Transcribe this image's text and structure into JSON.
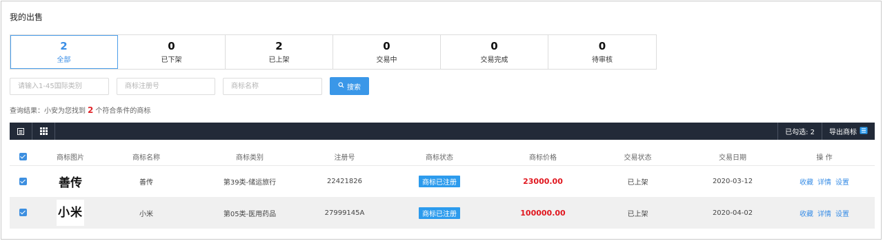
{
  "page": {
    "title": "我的出售"
  },
  "stats": [
    {
      "count": "2",
      "label": "全部",
      "active": true
    },
    {
      "count": "0",
      "label": "已下架"
    },
    {
      "count": "2",
      "label": "已上架"
    },
    {
      "count": "0",
      "label": "交易中"
    },
    {
      "count": "0",
      "label": "交易完成"
    },
    {
      "count": "0",
      "label": "待审核"
    }
  ],
  "filters": {
    "class_placeholder": "请输入1-45国际类别",
    "reg_no_placeholder": "商标注册号",
    "name_placeholder": "商标名称",
    "search_label": "搜索"
  },
  "result": {
    "prefix": "查询结果：小安为您找到",
    "count": "2",
    "suffix": "个符合条件的商标"
  },
  "toolbar": {
    "list_icon": "list-view-icon",
    "grid_icon": "grid-view-icon",
    "selected_label": "已勾选: 2",
    "export_label": "导出商标",
    "export_icon": "export-excel-icon"
  },
  "table": {
    "headers": [
      "商标图片",
      "商标名称",
      "商标类别",
      "注册号",
      "商标状态",
      "商标价格",
      "交易状态",
      "交易日期",
      "操 作"
    ],
    "rows": [
      {
        "image_text": "善传",
        "name": "善传",
        "category": "第39类-储运旅行",
        "reg_no": "22421826",
        "status": "商标已注册",
        "price": "23000.00",
        "trade_status": "已上架",
        "date": "2020-03-12",
        "actions": [
          "收藏",
          "详情",
          "设置"
        ]
      },
      {
        "image_text": "小米",
        "name": "小米",
        "category": "第05类-医用药品",
        "reg_no": "27999145A",
        "status": "商标已注册",
        "price": "100000.00",
        "trade_status": "已上架",
        "date": "2020-04-02",
        "actions": [
          "收藏",
          "详情",
          "设置"
        ]
      }
    ]
  },
  "colors": {
    "accent": "#3a97e8",
    "toolbar_bg": "#222a38",
    "price": "#e0161e",
    "badge": "#2c9bed"
  }
}
